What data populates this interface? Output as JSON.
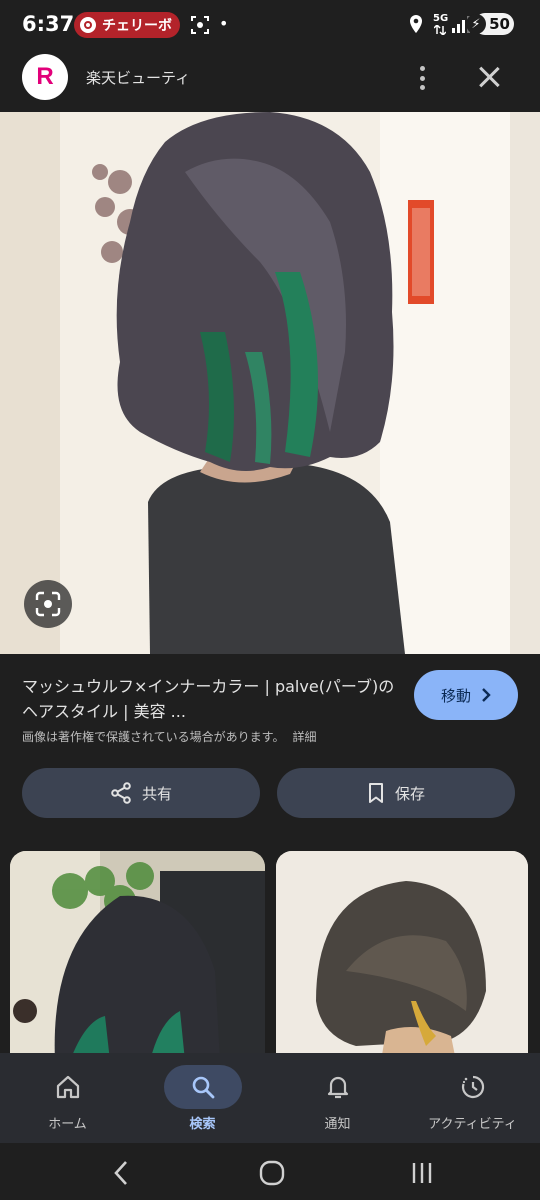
{
  "status_bar": {
    "time": "6:37",
    "notification_label": "チェリーボ",
    "network": "5G",
    "battery_level": "50"
  },
  "header": {
    "logo_letter": "R",
    "site_name": "楽天ビューティ"
  },
  "result": {
    "title": "マッシュウルフ×インナーカラー | palve(パーブ)のヘアスタイル | 美容 ...",
    "move_label": "移動",
    "copyright_notice": "画像は著作権で保護されている場合があります。",
    "detail_link": "詳細",
    "share_label": "共有",
    "save_label": "保存"
  },
  "bottom_nav": {
    "items": [
      {
        "label": "ホーム",
        "icon": "home-icon"
      },
      {
        "label": "検索",
        "icon": "search-icon"
      },
      {
        "label": "通知",
        "icon": "bell-icon"
      },
      {
        "label": "アクティビティ",
        "icon": "activity-icon"
      }
    ],
    "active_index": 1
  },
  "colors": {
    "background": "#1f1f1f",
    "accent_button": "#8ab4f8",
    "pill_button": "#3c4352",
    "notification_pill": "#b3232a",
    "brand": "#e2007a"
  }
}
